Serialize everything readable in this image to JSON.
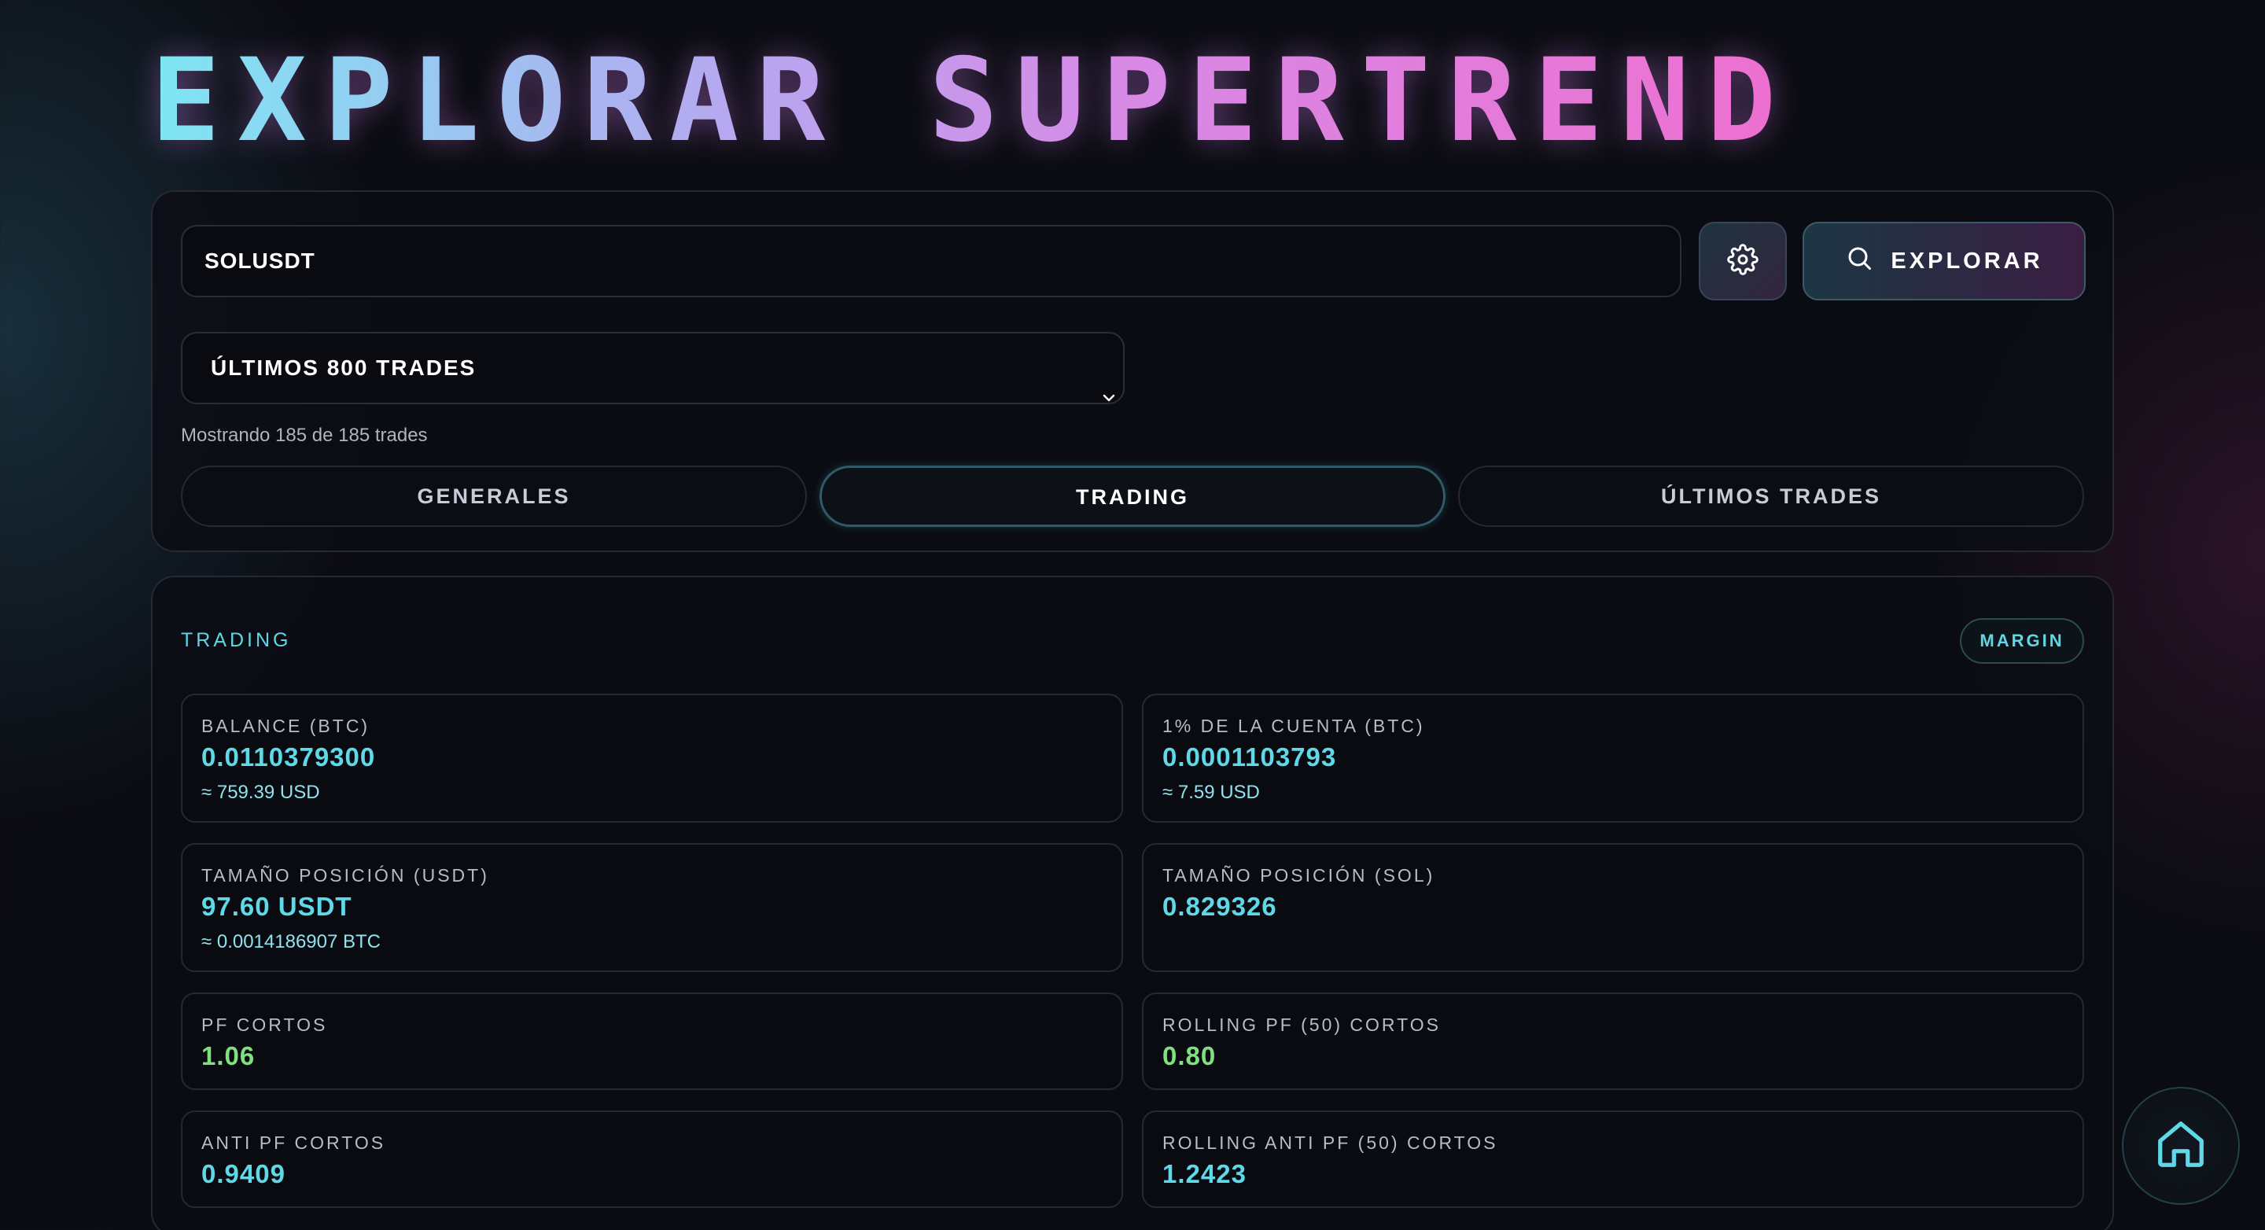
{
  "header": {
    "title": "EXPLORAR SUPERTREND"
  },
  "search": {
    "value": "SOLUSDT",
    "explore_label": "EXPLORAR"
  },
  "filter": {
    "selected": "ÚLTIMOS 800 TRADES",
    "count_text": "Mostrando 185 de 185 trades"
  },
  "tabs": [
    {
      "label": "GENERALES",
      "active": false
    },
    {
      "label": "TRADING",
      "active": true
    },
    {
      "label": "ÚLTIMOS TRADES",
      "active": false
    }
  ],
  "trading": {
    "section_title": "TRADING",
    "badge": "MARGIN",
    "cards": [
      {
        "label": "BALANCE (BTC)",
        "value": "0.0110379300",
        "sub": "≈ 759.39 USD"
      },
      {
        "label": "1% DE LA CUENTA (BTC)",
        "value": "0.0001103793",
        "sub": "≈ 7.59 USD"
      },
      {
        "label": "TAMAÑO POSICIÓN (USDT)",
        "value": "97.60 USDT",
        "sub": "≈ 0.0014186907 BTC"
      },
      {
        "label": "TAMAÑO POSICIÓN (SOL)",
        "value": "0.829326",
        "sub": ""
      },
      {
        "label": "PF CORTOS",
        "value": "1.06",
        "sub": ""
      },
      {
        "label": "ROLLING PF (50) CORTOS",
        "value": "0.80",
        "sub": ""
      },
      {
        "label": "ANTI PF CORTOS",
        "value": "0.9409",
        "sub": ""
      },
      {
        "label": "ROLLING ANTI PF (50) CORTOS",
        "value": "1.2423",
        "sub": ""
      }
    ]
  },
  "icons": {
    "settings": "gear-icon",
    "explore": "search-icon",
    "dropdown": "chevron-down-icon",
    "home": "home-icon"
  },
  "colors": {
    "accent_cyan": "#5fd9e8",
    "accent_green": "#7fe07f",
    "accent_pink": "#ee6fcf",
    "background": "#0b0c12"
  }
}
